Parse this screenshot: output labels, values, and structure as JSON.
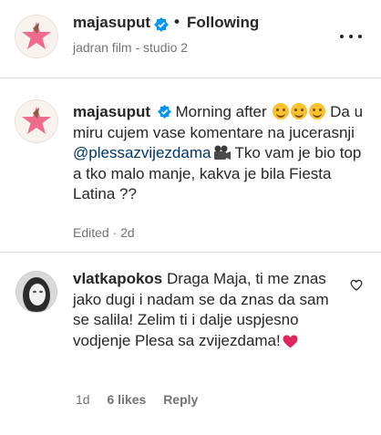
{
  "header": {
    "username": "majasuput",
    "separator": "•",
    "follow_status": "Following",
    "subtitle": "jadran film - studio 2",
    "more_icon": "more-horizontal-icon"
  },
  "caption": {
    "username": "majasuput",
    "text_before_mention": "Morning after",
    "line2": "Da u miru cujem vase komentare na jucerasnji",
    "mention": "@plessazvijezdama",
    "text_after_mention": "Tko vam je bio top a tko malo manje, kakva je bila Fiesta Latina ??",
    "emojis": [
      "smiling-face-icon",
      "smiling-face-icon",
      "smiling-face-icon"
    ],
    "camera_icon": "movie-camera-icon",
    "meta": "Edited · 2d"
  },
  "comment": {
    "username": "vlatkapokos",
    "text": "Draga Maja, ti me znas jako dugi i nadam se da znas da sam se salila! Zelim ti i dalje uspjesno vodjenje Plesa sa zvijezdama!",
    "emoji": "red-heart-icon",
    "age": "1d",
    "likes": "6 likes",
    "reply": "Reply"
  },
  "colors": {
    "text": "#262626",
    "secondary": "#737373",
    "mention": "#00376b",
    "verified": "#0095f6",
    "divider": "#dbdbdb",
    "heart": "#e0245e"
  }
}
